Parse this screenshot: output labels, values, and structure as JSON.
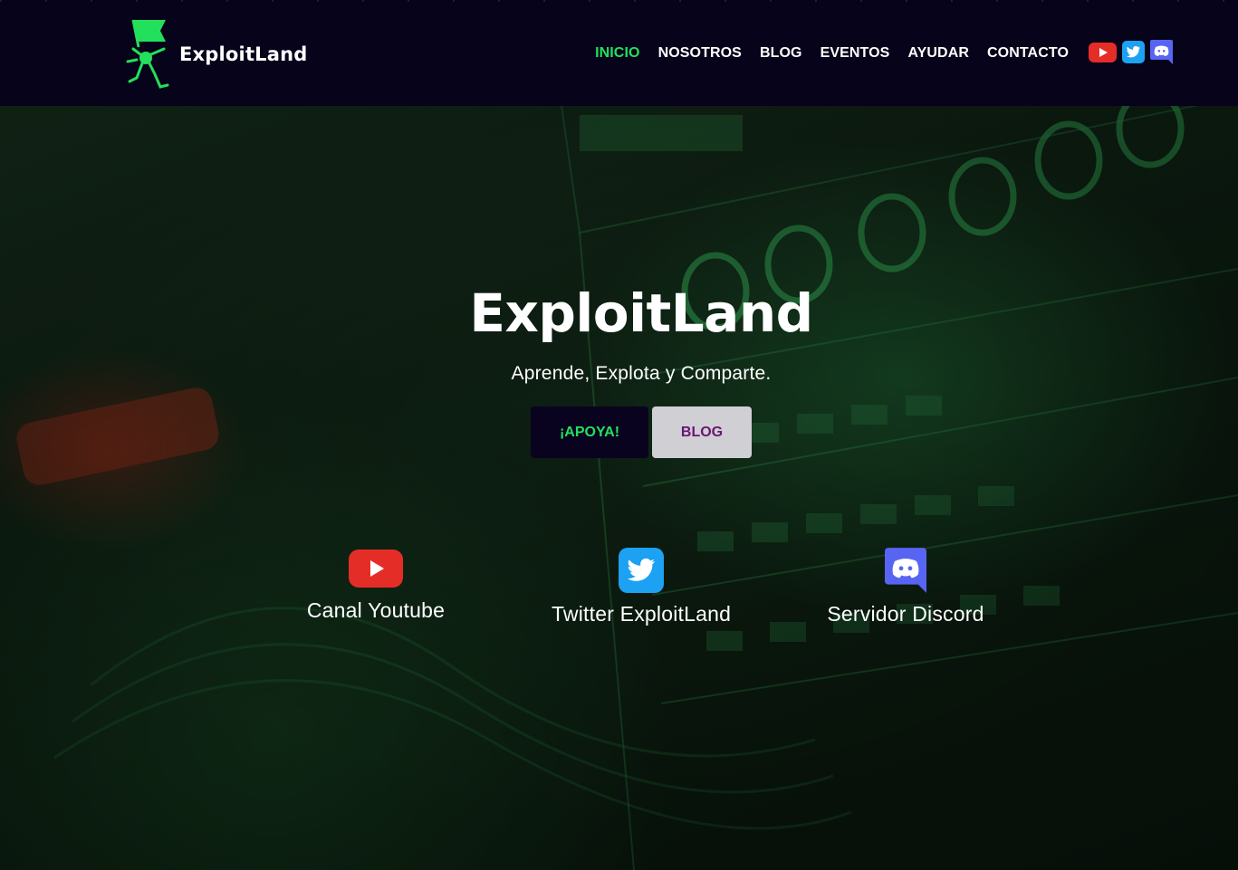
{
  "brand": {
    "name": "ExploitLand"
  },
  "nav": {
    "items": [
      {
        "label": "INICIO",
        "active": true
      },
      {
        "label": "NOSOTROS"
      },
      {
        "label": "BLOG"
      },
      {
        "label": "EVENTOS"
      },
      {
        "label": "AYUDAR"
      },
      {
        "label": "CONTACTO"
      }
    ],
    "social_icons": [
      "youtube-icon",
      "twitter-icon",
      "discord-icon"
    ]
  },
  "hero": {
    "title": "ExploitLand",
    "subtitle": "Aprende, Explota y Comparte.",
    "buttons": {
      "support": "¡APOYA!",
      "blog": "BLOG"
    },
    "social": [
      {
        "icon": "youtube-icon",
        "label": "Canal Youtube"
      },
      {
        "icon": "twitter-icon",
        "label": "Twitter ExploitLand"
      },
      {
        "icon": "discord-icon",
        "label": "Servidor Discord"
      }
    ]
  },
  "colors": {
    "header_bg": "#07031a",
    "accent_green": "#22e05c",
    "youtube_red": "#e52d27",
    "twitter_blue": "#1da1f2",
    "discord_purple": "#5865f2",
    "blog_button_bg": "#cfcfd4",
    "blog_button_text": "#6a1570"
  }
}
